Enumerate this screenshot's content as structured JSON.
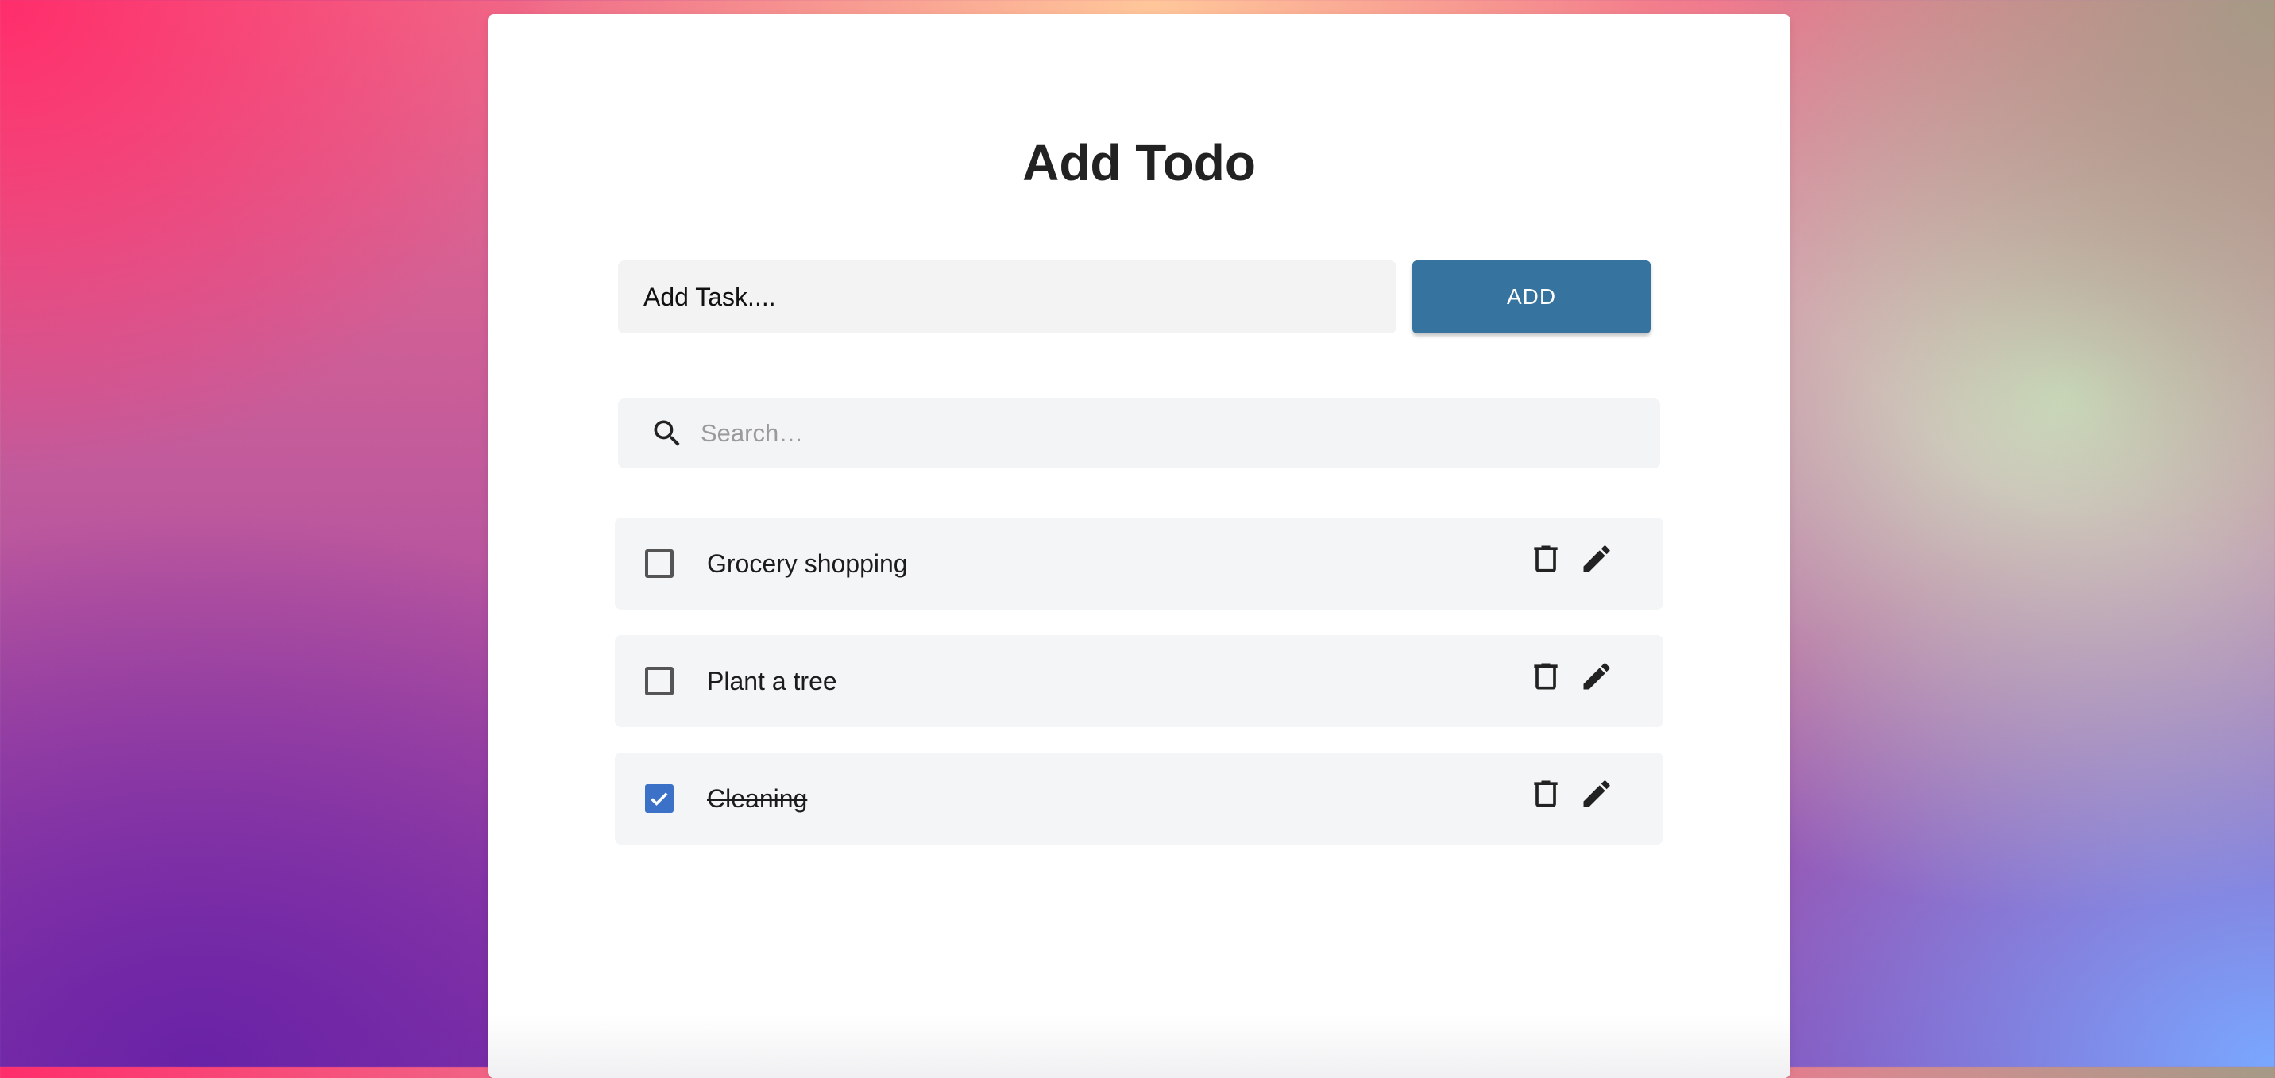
{
  "page": {
    "title": "Add Todo"
  },
  "add_form": {
    "input_value": "Add Task....",
    "button_label": "ADD"
  },
  "search": {
    "placeholder": "Search…",
    "icon": "search-icon"
  },
  "todos": [
    {
      "label": "Grocery shopping",
      "checked": false
    },
    {
      "label": "Plant a tree",
      "checked": false
    },
    {
      "label": "Cleaning",
      "checked": true
    }
  ],
  "icons": {
    "delete": "trash-icon",
    "edit": "pencil-icon",
    "check": "check-icon"
  },
  "colors": {
    "accent_button": "#36739e",
    "checkbox_checked": "#3b72c8",
    "field_background": "#f3f3f4"
  }
}
